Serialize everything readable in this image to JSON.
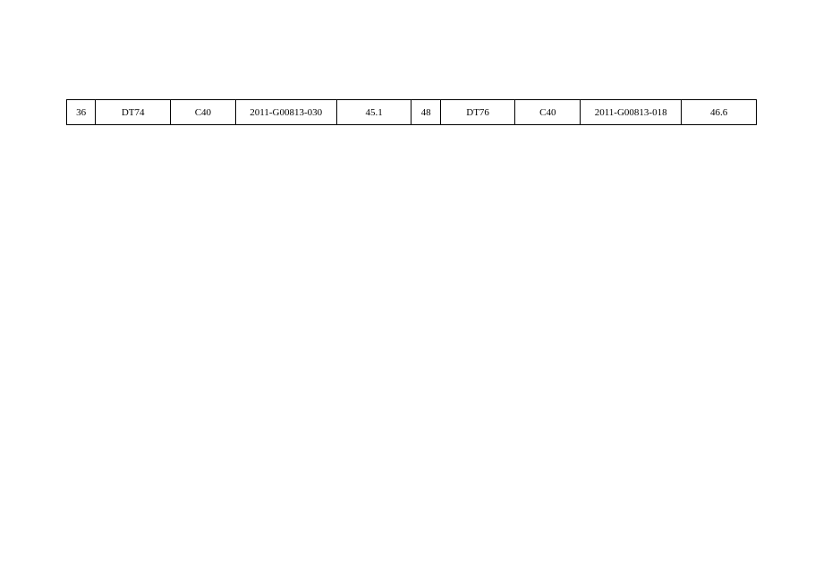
{
  "table": {
    "rows": [
      {
        "c1": "36",
        "c2": "DT74",
        "c3": "C40",
        "c4": "2011-G00813-030",
        "c5": "45.1",
        "c6": "48",
        "c7": "DT76",
        "c8": "C40",
        "c9": "2011-G00813-018",
        "c10": "46.6"
      }
    ]
  }
}
